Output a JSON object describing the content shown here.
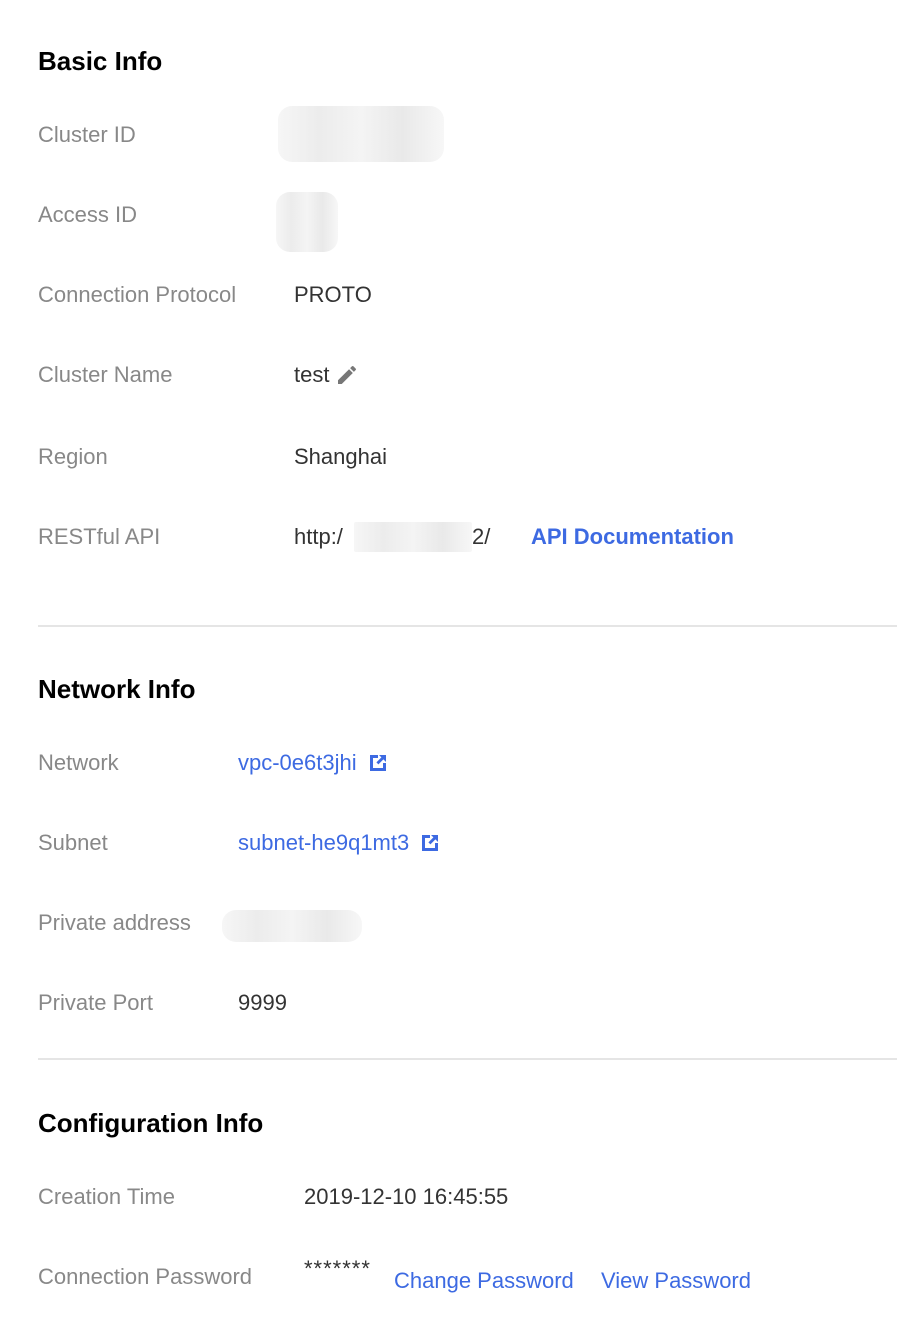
{
  "basic_info": {
    "title": "Basic Info",
    "cluster_id": {
      "label": "Cluster ID"
    },
    "access_id": {
      "label": "Access ID"
    },
    "connection_protocol": {
      "label": "Connection Protocol",
      "value": "PROTO"
    },
    "cluster_name": {
      "label": "Cluster Name",
      "value": "test",
      "edit_icon": "pencil-icon"
    },
    "region": {
      "label": "Region",
      "value": "Shanghai"
    },
    "restful_api": {
      "label": "RESTful API",
      "value_prefix": "http:/",
      "value_suffix": "2/",
      "doc_link": "API Documentation"
    }
  },
  "network_info": {
    "title": "Network Info",
    "network": {
      "label": "Network",
      "value": "vpc-0e6t3jhi",
      "icon": "external-link-icon"
    },
    "subnet": {
      "label": "Subnet",
      "value": "subnet-he9q1mt3",
      "icon": "external-link-icon"
    },
    "private_address": {
      "label": "Private address"
    },
    "private_port": {
      "label": "Private Port",
      "value": "9999"
    }
  },
  "configuration_info": {
    "title": "Configuration Info",
    "creation_time": {
      "label": "Creation Time",
      "value": "2019-12-10 16:45:55"
    },
    "connection_password": {
      "label": "Connection Password",
      "value": "*******",
      "change_link": "Change Password",
      "view_link": "View Password"
    }
  },
  "colors": {
    "link": "#3d6ae2",
    "label": "#888888",
    "value": "#333333",
    "divider": "#e5e5e5"
  }
}
